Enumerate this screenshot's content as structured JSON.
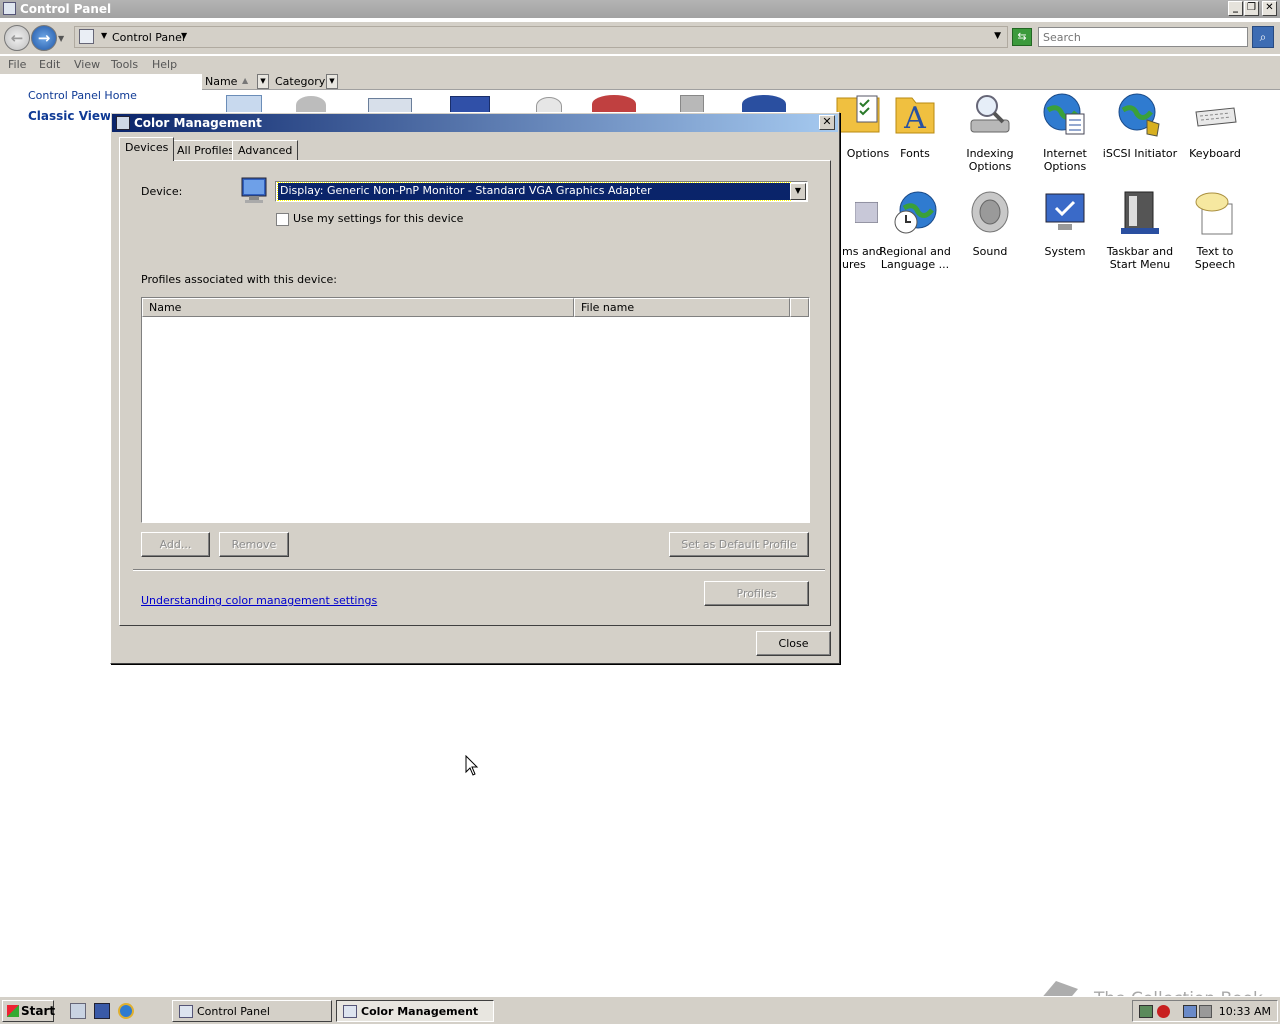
{
  "window": {
    "title": "Control Panel",
    "address": "Control Panel",
    "search_placeholder": "Search",
    "menu": [
      "File",
      "Edit",
      "View",
      "Tools",
      "Help"
    ],
    "sidebar": {
      "home_link": "Control Panel Home",
      "classic_view": "Classic View"
    },
    "columns": {
      "name": "Name",
      "category": "Category"
    },
    "icons": [
      {
        "label": "Options",
        "icon": "folder-options-icon"
      },
      {
        "label": "Fonts",
        "icon": "fonts-folder-icon"
      },
      {
        "label": "Indexing Options",
        "icon": "indexing-icon"
      },
      {
        "label": "Internet Options",
        "icon": "internet-options-icon"
      },
      {
        "label": "iSCSI Initiator",
        "icon": "iscsi-icon"
      },
      {
        "label": "Keyboard",
        "icon": "keyboard-icon"
      },
      {
        "label": "ms and ures",
        "icon": "programs-features-icon"
      },
      {
        "label": "Regional and Language ...",
        "icon": "regional-globe-icon"
      },
      {
        "label": "Sound",
        "icon": "speaker-icon"
      },
      {
        "label": "System",
        "icon": "system-icon"
      },
      {
        "label": "Taskbar and Start Menu",
        "icon": "taskbar-icon"
      },
      {
        "label": "Text to Speech",
        "icon": "speech-bubble-icon"
      }
    ]
  },
  "dialog": {
    "title": "Color Management",
    "tabs": [
      "Devices",
      "All Profiles",
      "Advanced"
    ],
    "active_tab": "Devices",
    "device_label": "Device:",
    "device_value": "Display: Generic Non-PnP Monitor - Standard VGA Graphics Adapter",
    "use_settings_label": "Use my settings for this device",
    "use_settings_checked": false,
    "profiles_label": "Profiles associated with this device:",
    "profiles_columns": [
      "Name",
      "File name"
    ],
    "profiles_rows": [],
    "buttons": {
      "add": "Add...",
      "remove": "Remove",
      "set_default": "Set as Default Profile",
      "profiles": "Profiles",
      "close": "Close"
    },
    "link": "Understanding color management settings"
  },
  "taskbar": {
    "start": "Start",
    "tasks": [
      {
        "label": "Control Panel",
        "active": false
      },
      {
        "label": "Color Management",
        "active": true
      }
    ],
    "clock": "10:33 AM"
  },
  "watermark": "The Collection Book",
  "colors": {
    "dialog_title_start": "#0a246a",
    "dialog_title_end": "#a6caf0",
    "selection": "#0a246a",
    "link": "#0000cc",
    "nav_link": "#0f3a95"
  }
}
